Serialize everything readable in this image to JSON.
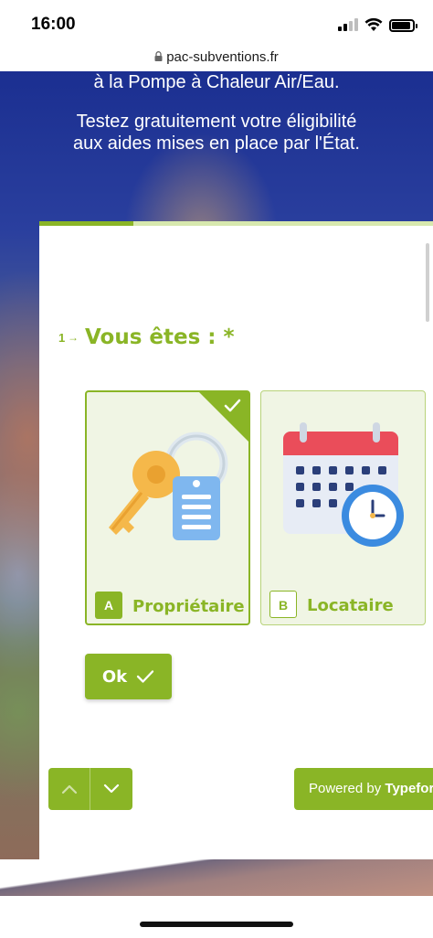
{
  "status_bar": {
    "time": "16:00"
  },
  "browser": {
    "url": "pac-subventions.fr"
  },
  "hero": {
    "title": "à la Pompe à Chaleur Air/Eau.",
    "subtitle_line1": "Testez gratuitement votre éligibilité",
    "subtitle_line2": "aux aides mises en place par l'État."
  },
  "form": {
    "progress": 0.24,
    "question": {
      "number": "1",
      "title": "Vous êtes : *"
    },
    "choices": [
      {
        "key": "A",
        "label": "Propriétaire",
        "selected": true,
        "icon": "keys-icon"
      },
      {
        "key": "B",
        "label": "Locataire",
        "selected": false,
        "icon": "calendar-clock-icon"
      }
    ],
    "ok_label": "Ok",
    "powered_by": "Powered by ",
    "powered_brand": "Typeform"
  },
  "colors": {
    "accent": "#8ab526",
    "choice_bg": "#f0f5e4",
    "hero_blue": "#1c2f8c"
  }
}
